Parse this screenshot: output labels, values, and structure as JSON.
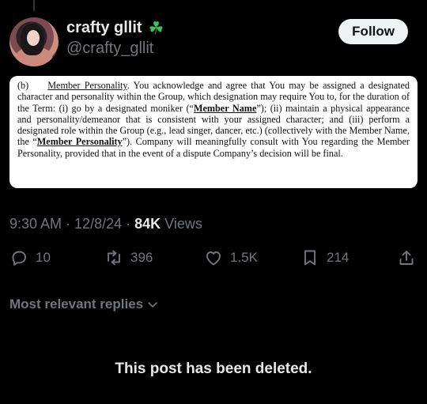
{
  "post": {
    "author": {
      "display_name": "crafty gllit",
      "badge_icon": "four-leaf-clover-icon",
      "handle": "@crafty_gllit"
    },
    "follow_label": "Follow",
    "document": {
      "section": "(b)",
      "heading": "Member Personality",
      "p1": ". You acknowledge and agree that You may be assigned a designated character and personality within the Group, which designation may require You to, for the duration of the Term: (i) go by a designated moniker (“",
      "term1": "Member Name",
      "p2": "”); (ii) maintain a physical appearance and personality/demeanor that is consistent with your assigned character; and (iii) perform a designated role within the Group (e.g., lead singer, dancer, etc.) (collectively with the Member Name, the “",
      "term2": "Member Personality",
      "p3": "”). Company will meaningfully consult with You regarding the Member Personality, provided that in the event of a dispute Company’s decision will be final."
    },
    "meta": {
      "time": "9:30 AM",
      "date": "12/8/24",
      "views_count": "84K",
      "views_label": "Views"
    },
    "actions": {
      "replies": "10",
      "reposts": "396",
      "likes": "1.5K",
      "bookmarks": "214"
    }
  },
  "replies": {
    "sort_label": "Most relevant replies",
    "deleted_notice": "This post has been deleted."
  }
}
